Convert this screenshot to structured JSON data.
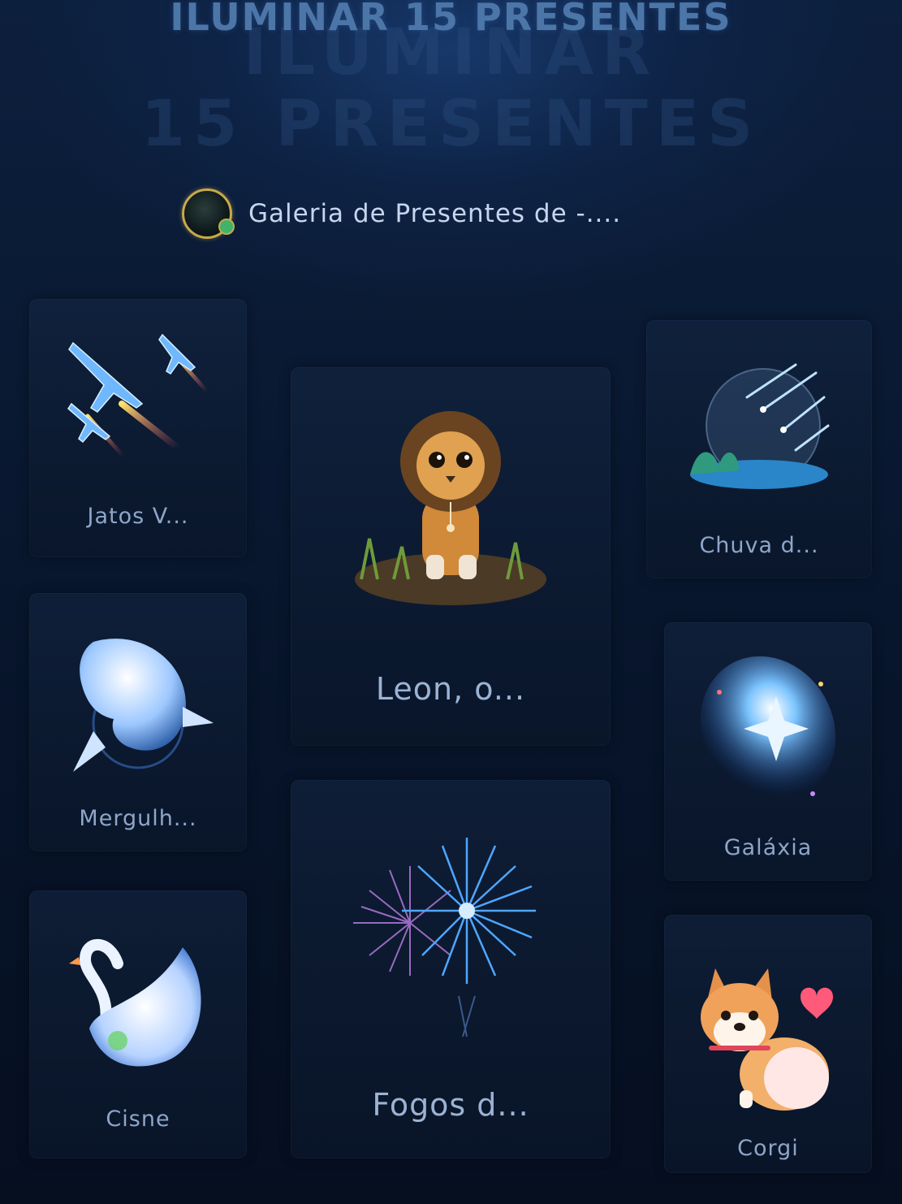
{
  "header": {
    "title": "ILUMINAR 15 PRESENTES",
    "watermark_line1": "ILUMINAR",
    "watermark_line2": "15 PRESENTES"
  },
  "owner": {
    "label": "Galeria de Presentes de -...."
  },
  "gifts": {
    "jets": {
      "label": "Jatos V...",
      "icon": "jets-icon"
    },
    "leon": {
      "label": "Leon, o...",
      "icon": "lion-icon"
    },
    "meteor": {
      "label": "Chuva d...",
      "icon": "meteor-shower-icon"
    },
    "whale": {
      "label": "Mergulh...",
      "icon": "whale-icon"
    },
    "galaxy": {
      "label": "Galáxia",
      "icon": "galaxy-icon"
    },
    "fireworks": {
      "label": "Fogos d...",
      "icon": "fireworks-icon"
    },
    "swan": {
      "label": "Cisne",
      "icon": "swan-icon"
    },
    "corgi": {
      "label": "Corgi",
      "icon": "corgi-icon"
    }
  },
  "colors": {
    "background": "#06101f",
    "title": "#4d76a8",
    "label": "#8ea6c8",
    "avatar_ring": "#c9a94a"
  }
}
